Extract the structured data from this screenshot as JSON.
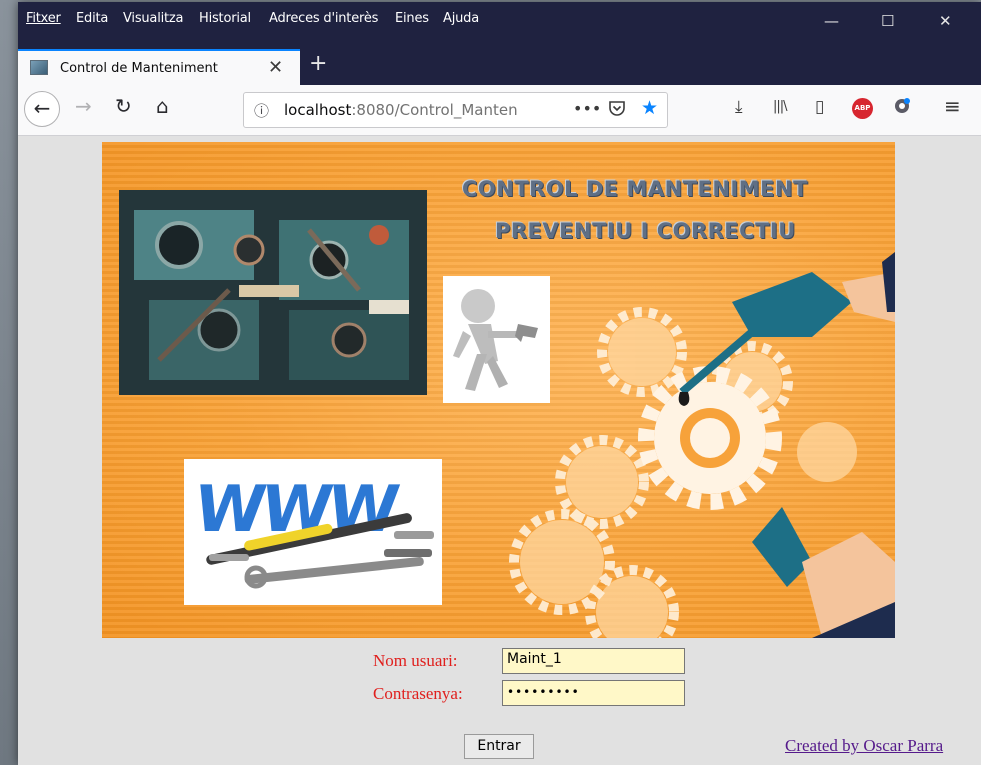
{
  "menu": [
    "Fitxer",
    "Edita",
    "Visualitza",
    "Historial",
    "Adreces d'interès",
    "Eines",
    "Ajuda"
  ],
  "window_controls": {
    "minimize": "—",
    "maximize": "☐",
    "close": "✕"
  },
  "tab": {
    "title": "Control de Manteniment",
    "close": "✕",
    "new_tab": "+"
  },
  "nav": {
    "back": "←",
    "forward": "→",
    "reload": "↻",
    "home": "⌂"
  },
  "url": {
    "info_icon": "ⓘ",
    "host": "localhost",
    "rest": ":8080/Control_Manten",
    "more": "•••"
  },
  "toolbar": {
    "download": "⤓",
    "library": "|||\\",
    "sidebar": "▯",
    "adblock": "ABP",
    "menu": "≡"
  },
  "banner": {
    "title_line1": "CONTROL DE MANTENIMENT",
    "title_line2": "PREVENTIU I CORRECTIU",
    "www_text": "WWW"
  },
  "login": {
    "username_label": "Nom usuari:",
    "username_value": "Maint_1",
    "password_label": "Contrasenya:",
    "password_value": "•••••••••",
    "submit_label": "Entrar",
    "credit": "Created by Oscar Parra"
  },
  "colors": {
    "accent": "#0a84ff",
    "titlebar": "#1f2240",
    "banner_orange": "#f9a237",
    "label_red": "#e0201e",
    "input_bg": "#fff8c8"
  }
}
